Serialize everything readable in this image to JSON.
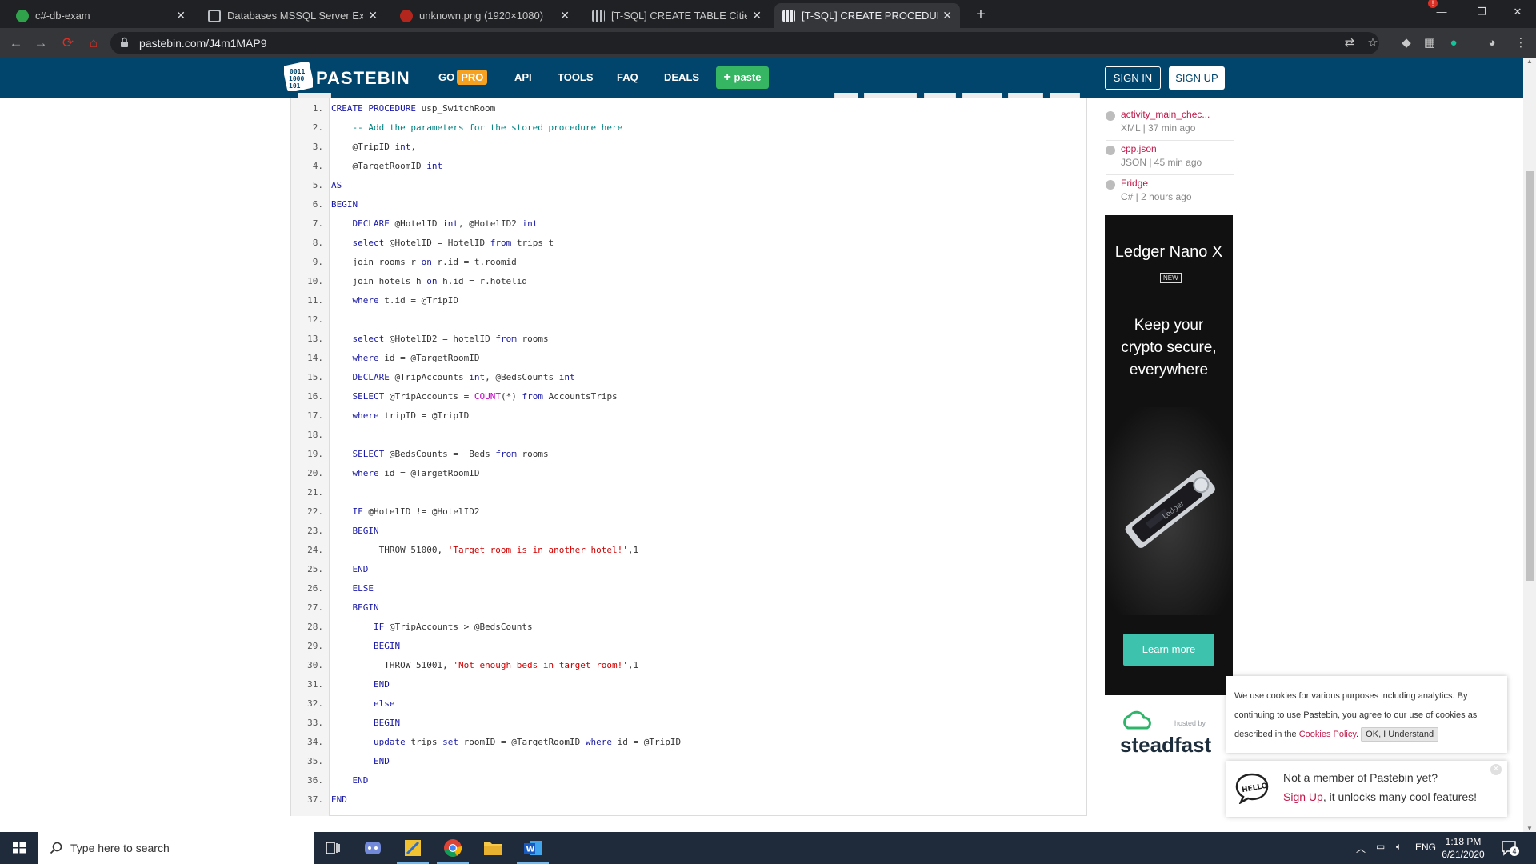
{
  "browser": {
    "tabs": [
      {
        "title": "c#-db-exam",
        "active": false,
        "favicon_color": "#31a24c"
      },
      {
        "title": "Databases MSSQL Server Exam",
        "active": false,
        "favicon_color": "#5f6368"
      },
      {
        "title": "unknown.png (1920×1080)",
        "active": false,
        "favicon_color": "#b3261e"
      },
      {
        "title": "[T-SQL] CREATE TABLE Cities ( Id",
        "active": false,
        "favicon_color": "#bdc1c6"
      },
      {
        "title": "[T-SQL] CREATE PROCEDURE usp",
        "active": true,
        "favicon_color": "#bdc1c6"
      }
    ],
    "new_tab": "+",
    "url": "pastebin.com/J4m1MAP9",
    "notification_count": "!"
  },
  "pastebin": {
    "logo_text": "PASTEBIN",
    "nav": {
      "go": "GO",
      "pro": "PRO",
      "api": "API",
      "tools": "TOOLS",
      "faq": "FAQ",
      "deals": "DEALS"
    },
    "paste_button": "paste",
    "sign_in": "SIGN IN",
    "sign_up": "SIGN UP",
    "brand_color": "#02456c"
  },
  "code": {
    "lines": [
      {
        "n": "1.",
        "html": "<span class='kw'>CREATE PROCEDURE</span> usp_SwitchRoom"
      },
      {
        "n": "2.",
        "html": "    <span class='cm'>-- Add the parameters for the stored procedure here</span>"
      },
      {
        "n": "3.",
        "html": "    @TripID <span class='kw'>int</span>,"
      },
      {
        "n": "4.",
        "html": "    @TargetRoomID <span class='kw'>int</span>"
      },
      {
        "n": "5.",
        "html": "<span class='kw'>AS</span>"
      },
      {
        "n": "6.",
        "html": "<span class='kw'>BEGIN</span>"
      },
      {
        "n": "7.",
        "html": "    <span class='kw'>DECLARE</span> @HotelID <span class='kw'>int</span>, @HotelID2 <span class='kw'>int</span>"
      },
      {
        "n": "8.",
        "html": "    <span class='kw'>select</span> @HotelID = HotelID <span class='kw'>from</span> trips t"
      },
      {
        "n": "9.",
        "html": "    join rooms r <span class='kw'>on</span> r.id = t.roomid"
      },
      {
        "n": "10.",
        "html": "    join hotels h <span class='kw'>on</span> h.id = r.hotelid"
      },
      {
        "n": "11.",
        "html": "    <span class='kw'>where</span> t.id = @TripID"
      },
      {
        "n": "12.",
        "html": ""
      },
      {
        "n": "13.",
        "html": "    <span class='kw'>select</span> @HotelID2 = hotelID <span class='kw'>from</span> rooms"
      },
      {
        "n": "14.",
        "html": "    <span class='kw'>where</span> id = @TargetRoomID"
      },
      {
        "n": "15.",
        "html": "    <span class='kw'>DECLARE</span> @TripAccounts <span class='kw'>int</span>, @BedsCounts <span class='kw'>int</span>"
      },
      {
        "n": "16.",
        "html": "    <span class='kw'>SELECT</span> @TripAccounts = <span class='fn'>COUNT</span>(*) <span class='kw'>from</span> AccountsTrips"
      },
      {
        "n": "17.",
        "html": "    <span class='kw'>where</span> tripID = @TripID"
      },
      {
        "n": "18.",
        "html": ""
      },
      {
        "n": "19.",
        "html": "    <span class='kw'>SELECT</span> @BedsCounts =  Beds <span class='kw'>from</span> rooms"
      },
      {
        "n": "20.",
        "html": "    <span class='kw'>where</span> id = @TargetRoomID"
      },
      {
        "n": "21.",
        "html": ""
      },
      {
        "n": "22.",
        "html": "    <span class='kw'>IF</span> @HotelID != @HotelID2"
      },
      {
        "n": "23.",
        "html": "    <span class='kw'>BEGIN</span>"
      },
      {
        "n": "24.",
        "html": "         THROW 51000, <span class='str'>'Target room is in another hotel!'</span>,1"
      },
      {
        "n": "25.",
        "html": "    <span class='kw'>END</span>"
      },
      {
        "n": "26.",
        "html": "    <span class='kw'>ELSE</span>"
      },
      {
        "n": "27.",
        "html": "    <span class='kw'>BEGIN</span>"
      },
      {
        "n": "28.",
        "html": "        <span class='kw'>IF</span> @TripAccounts > @BedsCounts"
      },
      {
        "n": "29.",
        "html": "        <span class='kw'>BEGIN</span>"
      },
      {
        "n": "30.",
        "html": "          THROW 51001, <span class='str'>'Not enough beds in target room!'</span>,1"
      },
      {
        "n": "31.",
        "html": "        <span class='kw'>END</span>"
      },
      {
        "n": "32.",
        "html": "        <span class='kw'>else</span>"
      },
      {
        "n": "33.",
        "html": "        <span class='kw'>BEGIN</span>"
      },
      {
        "n": "34.",
        "html": "        <span class='kw'>update</span> trips <span class='kw'>set</span> roomID = @TargetRoomID <span class='kw'>where</span> id = @TripID"
      },
      {
        "n": "35.",
        "html": "        <span class='kw'>END</span>"
      },
      {
        "n": "36.",
        "html": "    <span class='kw'>END</span>"
      },
      {
        "n": "37.",
        "html": "<span class='kw'>END</span>"
      }
    ]
  },
  "sidebar": {
    "pastes": [
      {
        "title": "activity_main_chec...",
        "meta": "XML | 37 min ago"
      },
      {
        "title": "cpp.json",
        "meta": "JSON | 45 min ago"
      },
      {
        "title": "Fridge",
        "meta": "C# | 2 hours ago"
      }
    ],
    "ad": {
      "brand_prefix": "Ledger ",
      "brand_model": "Nano X",
      "badge": "NEW",
      "headline_1": "Keep your",
      "headline_2": "crypto secure,",
      "headline_3": "everywhere",
      "cta": "Learn more",
      "cta_color": "#3cc2ad"
    },
    "hosted_by": "hosted by",
    "host_name": "steadfast"
  },
  "cookie": {
    "text": "We use cookies for various purposes including analytics. By continuing to use Pastebin, you agree to our use of cookies as described in the ",
    "link": "Cookies Policy",
    "after_link": ".",
    "ok": "OK, I Understand"
  },
  "member_popup": {
    "question": "Not a member of Pastebin yet?",
    "signup_link": "Sign Up",
    "rest": ", it unlocks many cool features!"
  },
  "taskbar": {
    "search_placeholder": "Type here to search",
    "lang": "ENG",
    "time": "1:18 PM",
    "date": "6/21/2020",
    "notif_count": "4"
  }
}
